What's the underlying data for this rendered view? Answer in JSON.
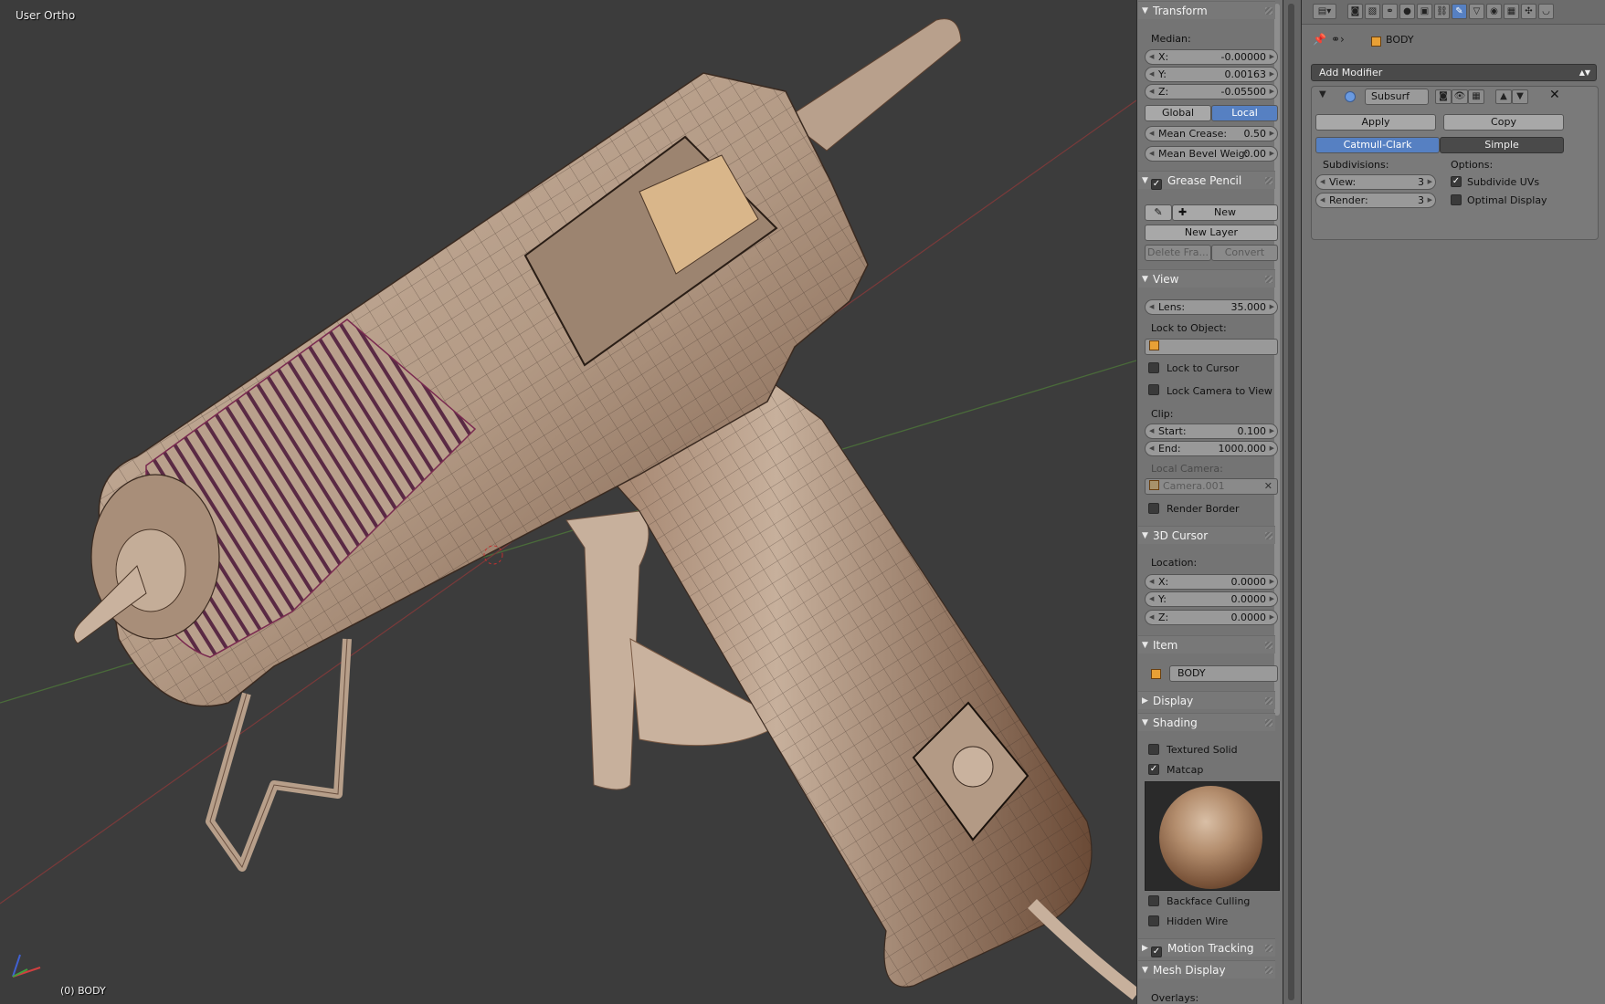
{
  "viewport": {
    "view_name": "User Ortho",
    "object_label": "(0) BODY"
  },
  "npanel": {
    "transform": {
      "header": "Transform",
      "median_label": "Median:",
      "x": {
        "label": "X:",
        "value": "-0.00000"
      },
      "y": {
        "label": "Y:",
        "value": "0.00163"
      },
      "z": {
        "label": "Z:",
        "value": "-0.05500"
      },
      "global_label": "Global",
      "local_label": "Local",
      "mean_crease": {
        "label": "Mean Crease:",
        "value": "0.50"
      },
      "mean_bevel": {
        "label": "Mean Bevel Weig:",
        "value": "0.00"
      }
    },
    "grease_pencil": {
      "header": "Grease Pencil",
      "new_label": "New",
      "new_layer_label": "New Layer",
      "delete_frame_label": "Delete Fra...",
      "convert_label": "Convert"
    },
    "view": {
      "header": "View",
      "lens": {
        "label": "Lens:",
        "value": "35.000"
      },
      "lock_to_object_label": "Lock to Object:",
      "lock_to_cursor_label": "Lock to Cursor",
      "lock_camera_label": "Lock Camera to View",
      "clip_label": "Clip:",
      "start": {
        "label": "Start:",
        "value": "0.100"
      },
      "end": {
        "label": "End:",
        "value": "1000.000"
      },
      "local_camera_label": "Local Camera:",
      "local_camera_value": "Camera.001",
      "render_border_label": "Render Border"
    },
    "cursor": {
      "header": "3D Cursor",
      "location_label": "Location:",
      "x": {
        "label": "X:",
        "value": "0.0000"
      },
      "y": {
        "label": "Y:",
        "value": "0.0000"
      },
      "z": {
        "label": "Z:",
        "value": "0.0000"
      }
    },
    "item": {
      "header": "Item",
      "name": "BODY"
    },
    "display": {
      "header": "Display"
    },
    "shading": {
      "header": "Shading",
      "textured_solid_label": "Textured Solid",
      "matcap_label": "Matcap",
      "backface_label": "Backface Culling",
      "hidden_wire_label": "Hidden Wire"
    },
    "motion_tracking": {
      "header": "Motion Tracking"
    },
    "mesh_display": {
      "header": "Mesh Display",
      "overlays_label": "Overlays:"
    }
  },
  "properties": {
    "breadcrumb_object": "BODY",
    "add_modifier_label": "Add Modifier",
    "modifier": {
      "name": "Subsurf",
      "apply_label": "Apply",
      "copy_label": "Copy",
      "catmull_label": "Catmull-Clark",
      "simple_label": "Simple",
      "subdivisions_label": "Subdivisions:",
      "options_label": "Options:",
      "view": {
        "label": "View:",
        "value": "3"
      },
      "render": {
        "label": "Render:",
        "value": "3"
      },
      "subdivide_uvs_label": "Subdivide UVs",
      "optimal_display_label": "Optimal Display"
    }
  },
  "colors": {
    "viewport_bg": "#3c3c3c",
    "panel_bg": "#747474",
    "selected_blue": "#5680c2",
    "mesh_color": "#b39a85",
    "matcap_highlight": "#d9bfa6"
  }
}
